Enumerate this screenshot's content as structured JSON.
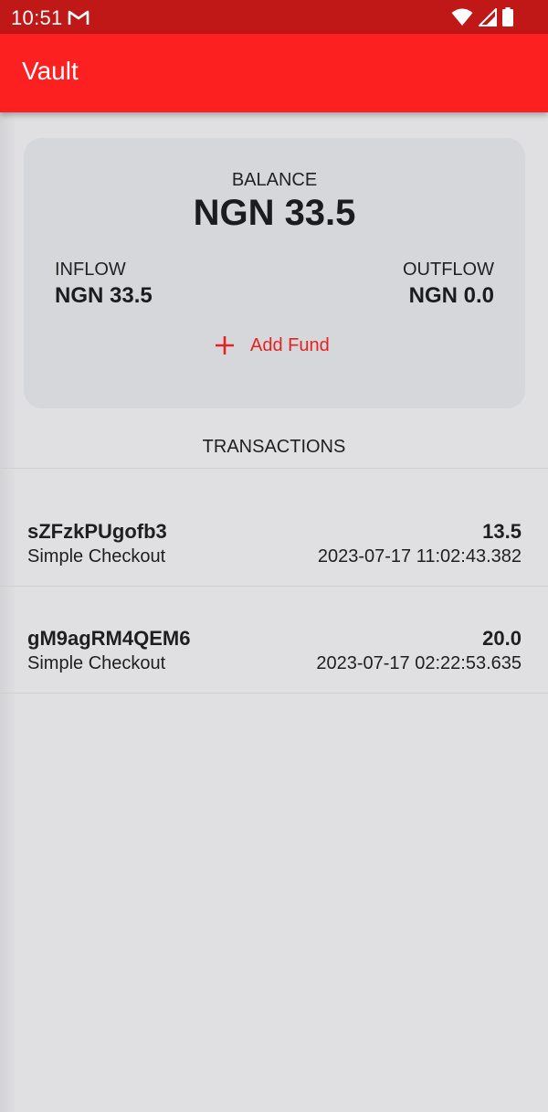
{
  "status_bar": {
    "time": "10:51",
    "icons": [
      "gmail-icon",
      "wifi-icon",
      "cell-signal-icon",
      "battery-icon"
    ]
  },
  "app_bar": {
    "title": "Vault"
  },
  "wallet": {
    "balance_label": "BALANCE",
    "balance_value": "NGN 33.5",
    "inflow_label": "INFLOW",
    "inflow_value": "NGN 33.5",
    "outflow_label": "OUTFLOW",
    "outflow_value": "NGN 0.0",
    "add_fund_label": "Add Fund",
    "add_fund_icon": "plus-icon"
  },
  "transactions": {
    "header": "TRANSACTIONS",
    "items": [
      {
        "id": "sZFzkPUgofb3",
        "type": "Simple Checkout",
        "amount": "13.5",
        "date": "2023-07-17 11:02:43.382"
      },
      {
        "id": "gM9agRM4QEM6",
        "type": "Simple Checkout",
        "amount": "20.0",
        "date": "2023-07-17 02:22:53.635"
      }
    ]
  },
  "colors": {
    "status_bar": "#c01717",
    "app_bar": "#fc2020",
    "accent": "#e52222",
    "background": "#e0dfe2",
    "card": "#d5d7da"
  }
}
